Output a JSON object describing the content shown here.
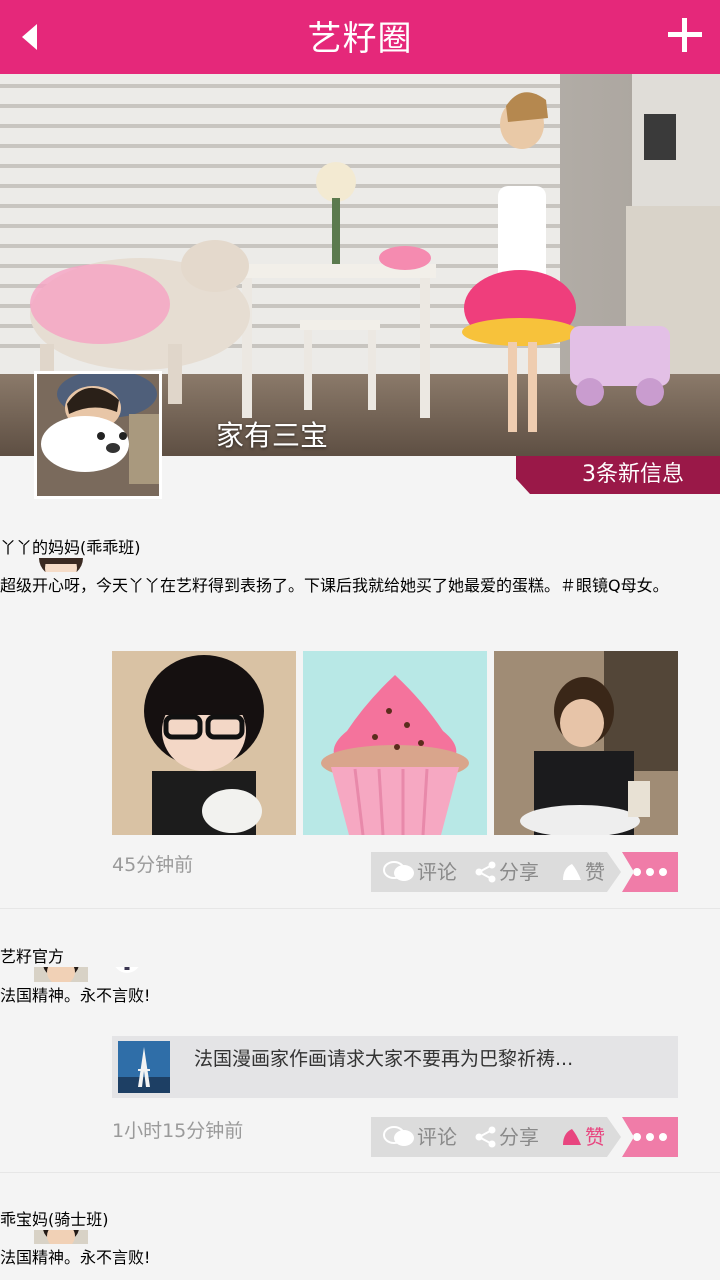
{
  "header": {
    "title": "艺籽圈"
  },
  "cover": {
    "name": "家有三宝",
    "new_messages": "3条新信息"
  },
  "posts": [
    {
      "author": "丫丫的妈妈(乖乖班)",
      "text": "超级开心呀，今天丫丫在艺籽得到表扬了。下课后我就给她买了她最爱的蛋糕。＃眼镜Q母女。",
      "time": "45分钟前",
      "actions": {
        "comment": "评论",
        "share": "分享",
        "like": "赞"
      }
    },
    {
      "author": "艺籽官方",
      "text": "法国精神。永不言败!",
      "share_title": "法国漫画家作画请求大家不要再为巴黎祈祷...",
      "time": "1小时15分钟前",
      "actions": {
        "comment": "评论",
        "share": "分享",
        "like": "赞"
      },
      "liked": true
    },
    {
      "author": "乖宝妈(骑士班)",
      "text": "法国精神。永不言败!"
    }
  ],
  "colors": {
    "brand": "#e5287a",
    "author": "#8b1a3c",
    "official": "#ea5d28",
    "badge": "#9a1848",
    "liked": "#e8457f"
  },
  "icons": [
    "back-arrow-icon",
    "plus-icon",
    "comment-icon",
    "share-icon",
    "like-icon",
    "more-icon"
  ]
}
